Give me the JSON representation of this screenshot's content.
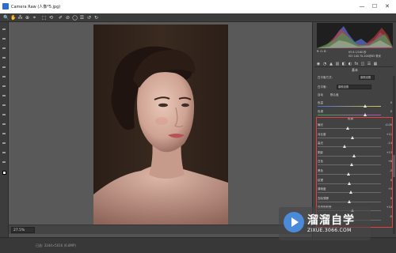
{
  "window": {
    "title": "Camera Raw (人像*5.jpg)",
    "controls": [
      "—",
      "☐",
      "✕"
    ]
  },
  "toolbar": {
    "tools": [
      "🔍",
      "✋",
      "⁂",
      "⊕",
      "⌖",
      "⬚",
      "⟲",
      "✐",
      "⊘",
      "◯",
      "☰",
      "↺",
      "↻"
    ]
  },
  "status": {
    "zoom": "27.5%",
    "bottom_info": "已选: 3344×5016 (6.8MP)"
  },
  "histogram_readout": {
    "line1": "R: G: B:",
    "line2": "f/5.6  1/160 秒",
    "line3": "ISO 100   70-200@85 毫米"
  },
  "panel": {
    "section": "基本",
    "profile_label": "白平衡方式:",
    "profile_value": "原照设置",
    "wb_label": "白平衡:",
    "wb_value": "原照设置",
    "auto_label": "自动",
    "default_label": "默认值",
    "tone_section": "色调",
    "sliders_top": [
      {
        "label": "色温",
        "value": "0"
      },
      {
        "label": "色调",
        "value": "0"
      }
    ],
    "sliders_main": [
      {
        "label": "曝光",
        "value": "-0.05",
        "pos": 0.48
      },
      {
        "label": "对比度",
        "value": "+11",
        "pos": 0.55
      },
      {
        "label": "高光",
        "value": "-14",
        "pos": 0.43
      },
      {
        "label": "阴影",
        "value": "+13",
        "pos": 0.57
      },
      {
        "label": "白色",
        "value": "+8",
        "pos": 0.54
      },
      {
        "label": "黑色",
        "value": "-3",
        "pos": 0.49
      },
      {
        "label": "纹理",
        "value": "0",
        "pos": 0.5
      },
      {
        "label": "清晰度",
        "value": "+5",
        "pos": 0.53
      },
      {
        "label": "去除薄雾",
        "value": "0",
        "pos": 0.5
      },
      {
        "label": "自然饱和度",
        "value": "+10",
        "pos": 0.55
      },
      {
        "label": "饱和度",
        "value": "-5",
        "pos": 0.47
      }
    ]
  },
  "watermark": {
    "cn_text": "溜溜自学",
    "url": "ZIXUE.3066.COM"
  }
}
